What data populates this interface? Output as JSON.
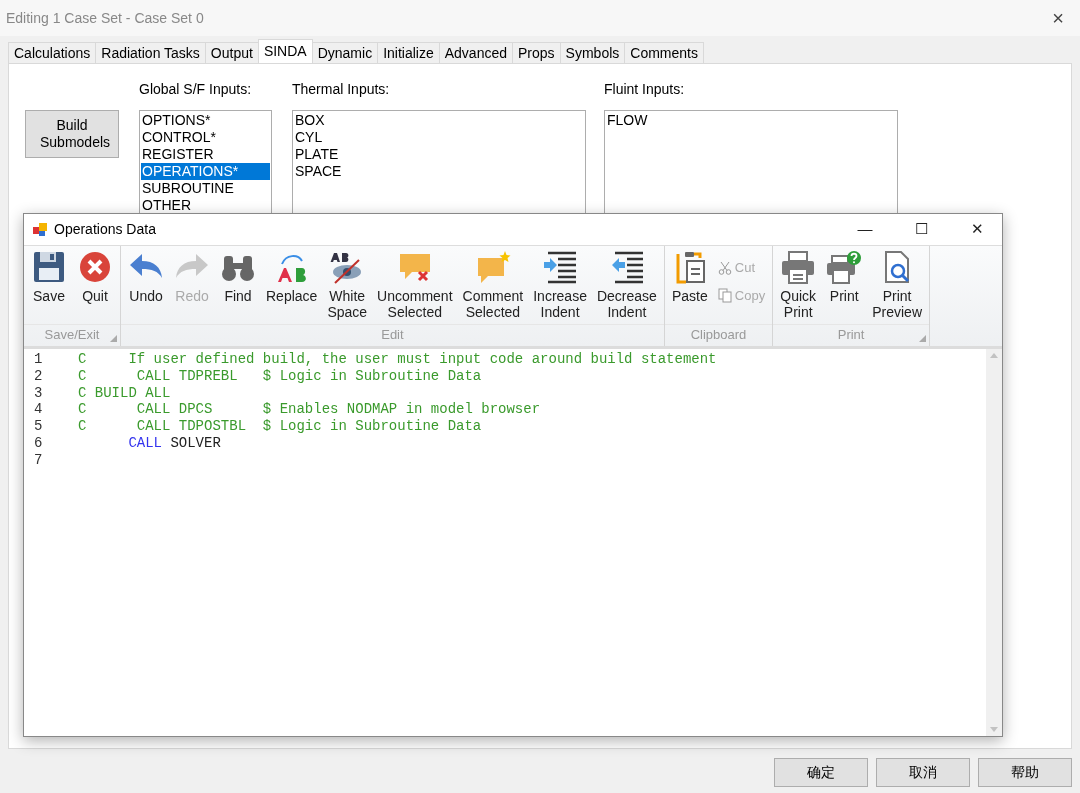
{
  "window": {
    "title": "Editing 1 Case Set - Case Set 0",
    "close": "×"
  },
  "tabs": [
    {
      "label": "Calculations",
      "selected": false
    },
    {
      "label": "Radiation Tasks",
      "selected": false
    },
    {
      "label": "Output",
      "selected": false
    },
    {
      "label": "SINDA",
      "selected": true
    },
    {
      "label": "Dynamic",
      "selected": false
    },
    {
      "label": "Initialize",
      "selected": false
    },
    {
      "label": "Advanced",
      "selected": false
    },
    {
      "label": "Props",
      "selected": false
    },
    {
      "label": "Symbols",
      "selected": false
    },
    {
      "label": "Comments",
      "selected": false
    }
  ],
  "build_button": "Build Submodels",
  "lists": [
    {
      "label": "Global S/F Inputs:",
      "items": [
        {
          "text": "OPTIONS*",
          "selected": false
        },
        {
          "text": "CONTROL*",
          "selected": false
        },
        {
          "text": "REGISTER",
          "selected": false
        },
        {
          "text": "OPERATIONS*",
          "selected": true
        },
        {
          "text": "SUBROUTINE",
          "selected": false
        },
        {
          "text": "OTHER",
          "selected": false
        }
      ]
    },
    {
      "label": "Thermal Inputs:",
      "items": [
        {
          "text": "BOX",
          "selected": false
        },
        {
          "text": "CYL",
          "selected": false
        },
        {
          "text": "PLATE",
          "selected": false
        },
        {
          "text": "SPACE",
          "selected": false
        }
      ]
    },
    {
      "label": "Fluint Inputs:",
      "items": [
        {
          "text": "FLOW",
          "selected": false
        }
      ]
    }
  ],
  "editor_window": {
    "title": "Operations Data",
    "controls": {
      "minimize": "—",
      "maximize": "☐",
      "close": "✕"
    },
    "ribbon": [
      {
        "label": "Save/Exit",
        "launcher": true,
        "items": [
          {
            "label": "Save",
            "kind": "large",
            "disabled": false
          },
          {
            "label": "Quit",
            "kind": "large",
            "disabled": false
          }
        ]
      },
      {
        "label": "Edit",
        "launcher": false,
        "items": [
          {
            "label": "Undo",
            "kind": "large",
            "disabled": false
          },
          {
            "label": "Redo",
            "kind": "large",
            "disabled": true
          },
          {
            "label": "Find",
            "kind": "large",
            "disabled": false
          },
          {
            "label": "Replace",
            "kind": "large",
            "disabled": false
          },
          {
            "label": "White Space",
            "kind": "large",
            "disabled": false
          },
          {
            "label": "Uncomment Selected",
            "kind": "large",
            "disabled": false
          },
          {
            "label": "Comment Selected",
            "kind": "large",
            "disabled": false
          },
          {
            "label": "Increase Indent",
            "kind": "large",
            "disabled": false
          },
          {
            "label": "Decrease Indent",
            "kind": "large",
            "disabled": false
          }
        ]
      },
      {
        "label": "Clipboard",
        "launcher": false,
        "items": [
          {
            "label": "Paste",
            "kind": "large",
            "disabled": false
          },
          {
            "label": "Cut",
            "kind": "small",
            "disabled": true
          },
          {
            "label": "Copy",
            "kind": "small",
            "disabled": true
          }
        ]
      },
      {
        "label": "Print",
        "launcher": true,
        "items": [
          {
            "label": "Quick Print",
            "kind": "large",
            "disabled": false
          },
          {
            "label": "Print",
            "kind": "large",
            "disabled": false
          },
          {
            "label": "Print Preview",
            "kind": "large",
            "disabled": false
          }
        ]
      }
    ],
    "code": [
      {
        "number": "1",
        "segments": [
          {
            "kind": "comment",
            "text": "C     If user defined build, the user must input code around build statement"
          }
        ]
      },
      {
        "number": "2",
        "segments": [
          {
            "kind": "comment",
            "text": "C      CALL TDPREBL   $ Logic in Subroutine Data"
          }
        ]
      },
      {
        "number": "3",
        "segments": [
          {
            "kind": "comment",
            "text": "C BUILD ALL"
          }
        ]
      },
      {
        "number": "4",
        "segments": [
          {
            "kind": "comment",
            "text": "C      CALL DPCS      $ Enables NODMAP in model browser"
          }
        ]
      },
      {
        "number": "5",
        "segments": [
          {
            "kind": "comment",
            "text": "C      CALL TDPOSTBL  $ Logic in Subroutine Data"
          }
        ]
      },
      {
        "number": "6",
        "segments": [
          {
            "kind": "keyword",
            "text": "      CALL"
          },
          {
            "kind": "plain",
            "text": " SOLVER"
          }
        ]
      },
      {
        "number": "7"
      }
    ]
  },
  "buttons": [
    "确定",
    "取消",
    "帮助"
  ]
}
